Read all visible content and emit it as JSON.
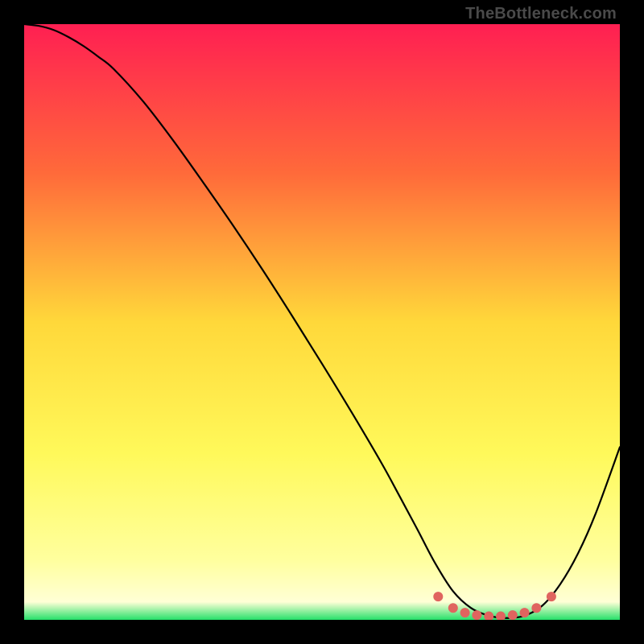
{
  "watermark": "TheBottleneck.com",
  "chart_data": {
    "type": "line",
    "title": "",
    "xlabel": "",
    "ylabel": "",
    "xlim": [
      0,
      100
    ],
    "ylim": [
      0,
      100
    ],
    "background_gradient_stops": [
      {
        "offset": 0.0,
        "color": "#ff1f52"
      },
      {
        "offset": 0.25,
        "color": "#ff6a3a"
      },
      {
        "offset": 0.5,
        "color": "#ffd83a"
      },
      {
        "offset": 0.72,
        "color": "#fff95a"
      },
      {
        "offset": 0.9,
        "color": "#ffff9e"
      },
      {
        "offset": 0.97,
        "color": "#ffffd6"
      },
      {
        "offset": 1.0,
        "color": "#26e06a"
      }
    ],
    "series": [
      {
        "name": "curve",
        "color": "#000000",
        "width": 2.2,
        "x": [
          0.0,
          2.5,
          5.0,
          7.5,
          10.0,
          12.5,
          15.0,
          20.0,
          25.0,
          30.0,
          35.0,
          40.0,
          45.0,
          50.0,
          55.0,
          60.0,
          63.0,
          66.0,
          69.0,
          72.0,
          75.0,
          78.0,
          81.0,
          84.0,
          87.0,
          90.0,
          93.0,
          96.0,
          100.0
        ],
        "values": [
          100.0,
          99.7,
          99.0,
          97.8,
          96.3,
          94.5,
          92.5,
          87.0,
          80.5,
          73.5,
          66.3,
          58.8,
          51.0,
          43.0,
          34.8,
          26.3,
          20.8,
          15.2,
          9.5,
          4.8,
          2.0,
          0.7,
          0.3,
          0.7,
          2.4,
          6.0,
          11.2,
          18.0,
          29.0
        ]
      }
    ],
    "highlight_dots": {
      "color": "#e0645f",
      "radius": 6,
      "points": [
        {
          "x": 69.5,
          "y": 3.9
        },
        {
          "x": 72.0,
          "y": 2.0
        },
        {
          "x": 74.0,
          "y": 1.2
        },
        {
          "x": 76.0,
          "y": 0.8
        },
        {
          "x": 78.0,
          "y": 0.6
        },
        {
          "x": 80.0,
          "y": 0.6
        },
        {
          "x": 82.0,
          "y": 0.8
        },
        {
          "x": 84.0,
          "y": 1.2
        },
        {
          "x": 86.0,
          "y": 2.0
        },
        {
          "x": 88.5,
          "y": 3.9
        }
      ]
    }
  }
}
